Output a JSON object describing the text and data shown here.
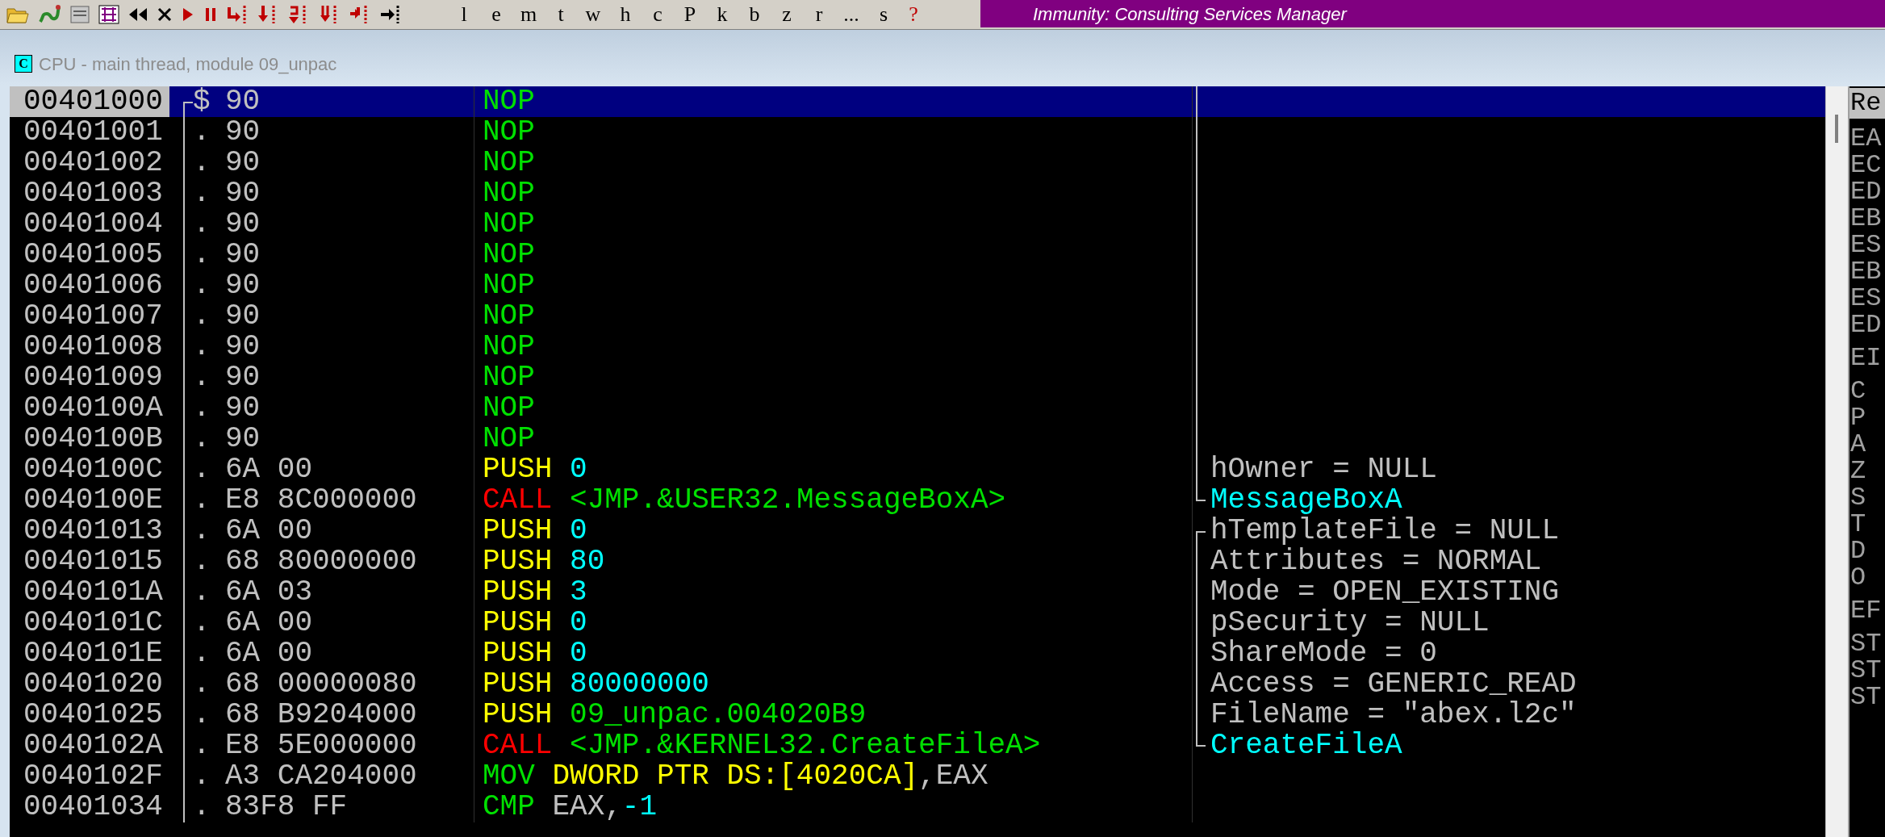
{
  "toolbar": {
    "letters": [
      "l",
      "e",
      "m",
      "t",
      "w",
      "h",
      "c",
      "P",
      "k",
      "b",
      "z",
      "r",
      "...",
      "s"
    ],
    "help": "?"
  },
  "banner": {
    "text": "Immunity: Consulting Services Manager"
  },
  "window": {
    "icon_letter": "C",
    "title": "CPU - main thread, module 09_unpac"
  },
  "disassembly": {
    "rows": [
      {
        "address": "00401000",
        "selected": true,
        "marker": "$",
        "hex_bracket": {
          "kind": "start"
        },
        "bytes": "90",
        "parts": [
          {
            "text": "NOP",
            "color": "#00e000"
          }
        ],
        "comment_bracket": {
          "kind": "mid"
        }
      },
      {
        "address": "00401001",
        "selected": false,
        "marker": ".",
        "hex_bracket": {
          "kind": "mid"
        },
        "bytes": "90",
        "parts": [
          {
            "text": "NOP",
            "color": "#00e000"
          }
        ],
        "comment_bracket": {
          "kind": "mid"
        }
      },
      {
        "address": "00401002",
        "selected": false,
        "marker": ".",
        "hex_bracket": {
          "kind": "mid"
        },
        "bytes": "90",
        "parts": [
          {
            "text": "NOP",
            "color": "#00e000"
          }
        ],
        "comment_bracket": {
          "kind": "mid"
        }
      },
      {
        "address": "00401003",
        "selected": false,
        "marker": ".",
        "hex_bracket": {
          "kind": "mid"
        },
        "bytes": "90",
        "parts": [
          {
            "text": "NOP",
            "color": "#00e000"
          }
        ],
        "comment_bracket": {
          "kind": "mid"
        }
      },
      {
        "address": "00401004",
        "selected": false,
        "marker": ".",
        "hex_bracket": {
          "kind": "mid"
        },
        "bytes": "90",
        "parts": [
          {
            "text": "NOP",
            "color": "#00e000"
          }
        ],
        "comment_bracket": {
          "kind": "mid"
        }
      },
      {
        "address": "00401005",
        "selected": false,
        "marker": ".",
        "hex_bracket": {
          "kind": "mid"
        },
        "bytes": "90",
        "parts": [
          {
            "text": "NOP",
            "color": "#00e000"
          }
        ],
        "comment_bracket": {
          "kind": "mid"
        }
      },
      {
        "address": "00401006",
        "selected": false,
        "marker": ".",
        "hex_bracket": {
          "kind": "mid"
        },
        "bytes": "90",
        "parts": [
          {
            "text": "NOP",
            "color": "#00e000"
          }
        ],
        "comment_bracket": {
          "kind": "mid"
        }
      },
      {
        "address": "00401007",
        "selected": false,
        "marker": ".",
        "hex_bracket": {
          "kind": "mid"
        },
        "bytes": "90",
        "parts": [
          {
            "text": "NOP",
            "color": "#00e000"
          }
        ],
        "comment_bracket": {
          "kind": "mid"
        }
      },
      {
        "address": "00401008",
        "selected": false,
        "marker": ".",
        "hex_bracket": {
          "kind": "mid"
        },
        "bytes": "90",
        "parts": [
          {
            "text": "NOP",
            "color": "#00e000"
          }
        ],
        "comment_bracket": {
          "kind": "mid"
        }
      },
      {
        "address": "00401009",
        "selected": false,
        "marker": ".",
        "hex_bracket": {
          "kind": "mid"
        },
        "bytes": "90",
        "parts": [
          {
            "text": "NOP",
            "color": "#00e000"
          }
        ],
        "comment_bracket": {
          "kind": "mid"
        }
      },
      {
        "address": "0040100A",
        "selected": false,
        "marker": ".",
        "hex_bracket": {
          "kind": "mid"
        },
        "bytes": "90",
        "parts": [
          {
            "text": "NOP",
            "color": "#00e000"
          }
        ],
        "comment_bracket": {
          "kind": "mid"
        }
      },
      {
        "address": "0040100B",
        "selected": false,
        "marker": ".",
        "hex_bracket": {
          "kind": "mid"
        },
        "bytes": "90",
        "parts": [
          {
            "text": "NOP",
            "color": "#00e000"
          }
        ],
        "comment_bracket": {
          "kind": "mid"
        }
      },
      {
        "address": "0040100C",
        "selected": false,
        "marker": ".",
        "hex_bracket": {
          "kind": "mid"
        },
        "bytes": "6A 00",
        "parts": [
          {
            "text": "PUSH ",
            "color": "#ffff00"
          },
          {
            "text": "0",
            "color": "#00ffff"
          }
        ],
        "comment_bracket": {
          "kind": "mid"
        },
        "comment": {
          "text": "hOwner = NULL",
          "color": "#c0c0c0"
        }
      },
      {
        "address": "0040100E",
        "selected": false,
        "marker": ".",
        "hex_bracket": {
          "kind": "mid"
        },
        "bytes": "E8 8C000000",
        "parts": [
          {
            "text": "CALL ",
            "color": "#ff0000"
          },
          {
            "text": "<JMP.&USER32.MessageBoxA>",
            "color": "#00e000"
          }
        ],
        "comment_bracket": {
          "kind": "end"
        },
        "comment": {
          "text": "MessageBoxA",
          "color": "#00ffff"
        }
      },
      {
        "address": "00401013",
        "selected": false,
        "marker": ".",
        "hex_bracket": {
          "kind": "mid"
        },
        "bytes": "6A 00",
        "parts": [
          {
            "text": "PUSH ",
            "color": "#ffff00"
          },
          {
            "text": "0",
            "color": "#00ffff"
          }
        ],
        "comment_bracket": {
          "kind": "start"
        },
        "comment": {
          "text": "hTemplateFile = NULL",
          "color": "#c0c0c0"
        }
      },
      {
        "address": "00401015",
        "selected": false,
        "marker": ".",
        "hex_bracket": {
          "kind": "mid"
        },
        "bytes": "68 80000000",
        "parts": [
          {
            "text": "PUSH ",
            "color": "#ffff00"
          },
          {
            "text": "80",
            "color": "#00ffff"
          }
        ],
        "comment_bracket": {
          "kind": "mid"
        },
        "comment": {
          "text": "Attributes = NORMAL",
          "color": "#c0c0c0"
        }
      },
      {
        "address": "0040101A",
        "selected": false,
        "marker": ".",
        "hex_bracket": {
          "kind": "mid"
        },
        "bytes": "6A 03",
        "parts": [
          {
            "text": "PUSH ",
            "color": "#ffff00"
          },
          {
            "text": "3",
            "color": "#00ffff"
          }
        ],
        "comment_bracket": {
          "kind": "mid"
        },
        "comment": {
          "text": "Mode = OPEN_EXISTING",
          "color": "#c0c0c0"
        }
      },
      {
        "address": "0040101C",
        "selected": false,
        "marker": ".",
        "hex_bracket": {
          "kind": "mid"
        },
        "bytes": "6A 00",
        "parts": [
          {
            "text": "PUSH ",
            "color": "#ffff00"
          },
          {
            "text": "0",
            "color": "#00ffff"
          }
        ],
        "comment_bracket": {
          "kind": "mid"
        },
        "comment": {
          "text": "pSecurity = NULL",
          "color": "#c0c0c0"
        }
      },
      {
        "address": "0040101E",
        "selected": false,
        "marker": ".",
        "hex_bracket": {
          "kind": "mid"
        },
        "bytes": "6A 00",
        "parts": [
          {
            "text": "PUSH ",
            "color": "#ffff00"
          },
          {
            "text": "0",
            "color": "#00ffff"
          }
        ],
        "comment_bracket": {
          "kind": "mid"
        },
        "comment": {
          "text": "ShareMode = 0",
          "color": "#c0c0c0"
        }
      },
      {
        "address": "00401020",
        "selected": false,
        "marker": ".",
        "hex_bracket": {
          "kind": "mid"
        },
        "bytes": "68 00000080",
        "parts": [
          {
            "text": "PUSH ",
            "color": "#ffff00"
          },
          {
            "text": "80000000",
            "color": "#00ffff"
          }
        ],
        "comment_bracket": {
          "kind": "mid"
        },
        "comment": {
          "text": "Access = GENERIC_READ",
          "color": "#c0c0c0"
        }
      },
      {
        "address": "00401025",
        "selected": false,
        "marker": ".",
        "hex_bracket": {
          "kind": "mid"
        },
        "bytes": "68 B9204000",
        "parts": [
          {
            "text": "PUSH ",
            "color": "#ffff00"
          },
          {
            "text": "09_unpac.004020B9",
            "color": "#00e000"
          }
        ],
        "comment_bracket": {
          "kind": "mid"
        },
        "comment": {
          "text": "FileName = \"abex.l2c\"",
          "color": "#c0c0c0"
        }
      },
      {
        "address": "0040102A",
        "selected": false,
        "marker": ".",
        "hex_bracket": {
          "kind": "mid"
        },
        "bytes": "E8 5E000000",
        "parts": [
          {
            "text": "CALL ",
            "color": "#ff0000"
          },
          {
            "text": "<JMP.&KERNEL32.CreateFileA>",
            "color": "#00e000"
          }
        ],
        "comment_bracket": {
          "kind": "end"
        },
        "comment": {
          "text": "CreateFileA",
          "color": "#00ffff"
        }
      },
      {
        "address": "0040102F",
        "selected": false,
        "marker": ".",
        "hex_bracket": {
          "kind": "mid"
        },
        "bytes": "A3 CA204000",
        "parts": [
          {
            "text": "MOV ",
            "color": "#00e000"
          },
          {
            "text": "DWORD PTR DS:[4020CA]",
            "color": "#ffff00"
          },
          {
            "text": ",EAX",
            "color": "#c0c0c0"
          }
        ]
      },
      {
        "address": "00401034",
        "selected": false,
        "marker": ".",
        "hex_bracket": {
          "kind": "mid"
        },
        "bytes": "83F8 FF",
        "parts": [
          {
            "text": "CMP ",
            "color": "#00e000"
          },
          {
            "text": "EAX,",
            "color": "#c0c0c0"
          },
          {
            "text": "-1",
            "color": "#00ffff"
          }
        ]
      }
    ]
  },
  "registers": {
    "header": "Re",
    "groups": [
      [
        "EA",
        "EC",
        "ED",
        "EB",
        "ES",
        "EB",
        "ES",
        "ED"
      ],
      [
        "EI"
      ],
      [
        "C",
        "P",
        "A",
        "Z",
        "S",
        "T",
        "D",
        "O"
      ],
      [
        "EF"
      ],
      [
        "ST",
        "ST",
        "ST"
      ]
    ]
  }
}
